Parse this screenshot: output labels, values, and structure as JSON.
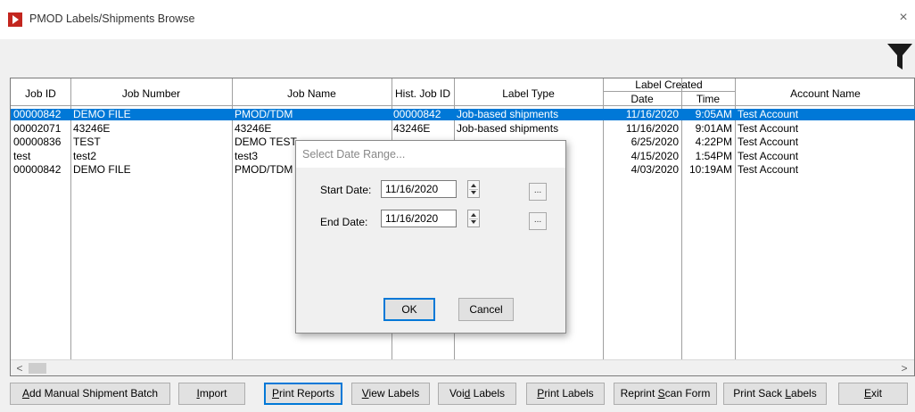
{
  "window": {
    "title": "PMOD Labels/Shipments Browse",
    "close_glyph": "×"
  },
  "icons": {
    "app": "pmod-app-icon",
    "filter": "filter-icon",
    "close": "close-icon"
  },
  "grid": {
    "headers": {
      "job_id": "Job ID",
      "job_number": "Job Number",
      "job_name": "Job Name",
      "hist_job_id": "Hist. Job ID",
      "label_type": "Label Type",
      "label_created": "Label Created",
      "date": "Date",
      "time": "Time",
      "account_name": "Account Name"
    },
    "rows": [
      {
        "job_id": "00000842",
        "job_number": "DEMO FILE",
        "job_name": "PMOD/TDM",
        "hist_job_id": "00000842",
        "label_type": "Job-based shipments",
        "date": "11/16/2020",
        "time": "9:05AM",
        "account": "Test Account",
        "selected": true
      },
      {
        "job_id": "00002071",
        "job_number": "43246E",
        "job_name": "43246E",
        "hist_job_id": "43246E",
        "label_type": "Job-based shipments",
        "date": "11/16/2020",
        "time": "9:01AM",
        "account": "Test Account",
        "selected": false
      },
      {
        "job_id": "00000836",
        "job_number": "TEST",
        "job_name": "DEMO TEST",
        "hist_job_id": "",
        "label_type": "",
        "date": "6/25/2020",
        "time": "4:22PM",
        "account": "Test Account",
        "selected": false
      },
      {
        "job_id": "test",
        "job_number": "test2",
        "job_name": "test3",
        "hist_job_id": "",
        "label_type": "ments",
        "date": "4/15/2020",
        "time": "1:54PM",
        "account": "Test Account",
        "selected": false
      },
      {
        "job_id": "00000842",
        "job_number": "DEMO FILE",
        "job_name": "PMOD/TDM",
        "hist_job_id": "",
        "label_type": "",
        "date": "4/03/2020",
        "time": "10:19AM",
        "account": "Test Account",
        "selected": false
      }
    ]
  },
  "scrollbar": {
    "left_arrow": "<",
    "right_arrow": ">"
  },
  "dialog": {
    "title": "Select Date Range...",
    "start_label": "Start Date:",
    "start_value": "11/16/2020",
    "end_label": "End Date:",
    "end_value": "11/16/2020",
    "picker_glyph": "...",
    "ok_label": "OK",
    "cancel_label": "Cancel"
  },
  "buttons": {
    "add_manual": {
      "pre": "",
      "u": "A",
      "post": "dd Manual Shipment Batch"
    },
    "import": {
      "pre": "",
      "u": "I",
      "post": "mport"
    },
    "print_reports": {
      "pre": "",
      "u": "P",
      "post": "rint Reports"
    },
    "view_labels": {
      "pre": "",
      "u": "V",
      "post": "iew Labels"
    },
    "void_labels": {
      "pre": "Voi",
      "u": "d",
      "post": " Labels"
    },
    "print_labels": {
      "pre": "",
      "u": "P",
      "post": "rint Labels"
    },
    "reprint_scan": {
      "pre": "Reprint ",
      "u": "S",
      "post": "can Form"
    },
    "print_sack": {
      "pre": "Print Sack ",
      "u": "L",
      "post": "abels"
    },
    "exit": {
      "pre": "",
      "u": "E",
      "post": "xit"
    }
  },
  "colors": {
    "selection": "#0078d7",
    "app_icon": "#c3261f",
    "focus_border": "#0078d7"
  }
}
